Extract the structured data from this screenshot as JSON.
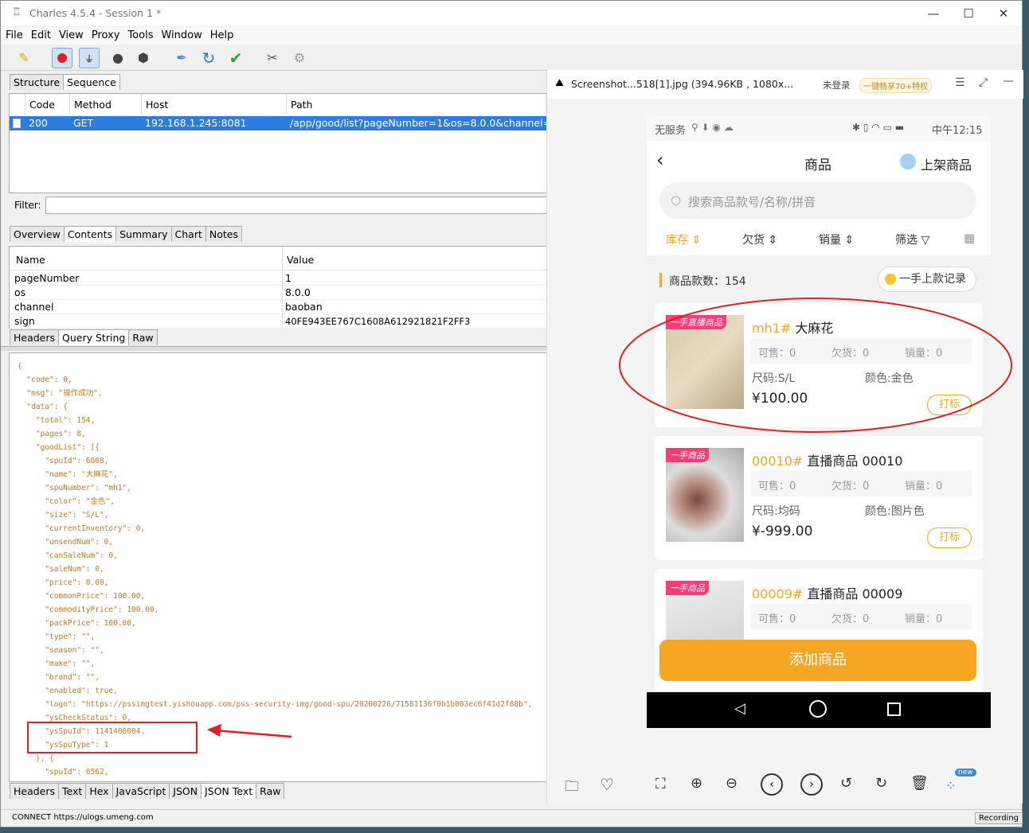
{
  "window": {
    "title": "Charles 4.5.4 - Session 1 *",
    "min": "—",
    "max": "☐",
    "close": "✕"
  },
  "menu": [
    "File",
    "Edit",
    "View",
    "Proxy",
    "Tools",
    "Window",
    "Help"
  ],
  "tabs_top": {
    "structure": "Structure",
    "sequence": "Sequence"
  },
  "table": {
    "headers": [
      "Code",
      "Method",
      "Host",
      "Path"
    ],
    "row": {
      "code": "200",
      "method": "GET",
      "host": "192.168.1.245:8081",
      "path": "/app/good/list?pageNumber=1&os=8.0.0&channel=baob"
    }
  },
  "filter_label": "Filter:",
  "detail_tabs": [
    "Overview",
    "Contents",
    "Summary",
    "Chart",
    "Notes"
  ],
  "kv": {
    "headers": [
      "Name",
      "Value"
    ],
    "rows": [
      {
        "n": "pageNumber",
        "v": "1"
      },
      {
        "n": "os",
        "v": "8.0.0"
      },
      {
        "n": "channel",
        "v": "baoban"
      },
      {
        "n": "sign",
        "v": "40FE943EE767C1608A612921821F2FF3"
      }
    ]
  },
  "sub_tabs": [
    "Headers",
    "Query String",
    "Raw"
  ],
  "json_lines": [
    "{",
    "  \"code\": 0,",
    "  \"msg\": \"操作成功\",",
    "  \"data\": {",
    "    \"total\": 154,",
    "    \"pages\": 8,",
    "    \"goodList\": [{",
    "      \"spuId\": 6808,",
    "      \"name\": \"大麻花\",",
    "      \"spuNumber\": \"mh1\",",
    "      \"color\": \"金色\",",
    "      \"size\": \"S/L\",",
    "      \"currentInventory\": 0,",
    "      \"unsendNum\": 0,",
    "      \"canSaleNum\": 0,",
    "      \"saleNum\": 0,",
    "      \"price\": 0.00,",
    "      \"commonPrice\": 100.00,",
    "      \"commodityPrice\": 100.00,",
    "      \"packPrice\": 100.00,",
    "      \"type\": \"\",",
    "      \"season\": \"\",",
    "      \"make\": \"\",",
    "      \"brand\": \"\",",
    "      \"enabled\": true,",
    "      \"logo\": \"https://pssimgtest.yishouapp.com/pss-security-img/good-spu/20200226/71581136f0b1b003ec6f41d2f88b\",",
    "      \"ysCheckStatus\": 0,",
    "      \"ysSpuId\": 1141400004,",
    "      \"ysSpuType\": 1",
    "    }, {",
    "      \"spuId\": 6562,"
  ],
  "bottom_tabs": [
    "Headers",
    "Text",
    "Hex",
    "JavaScript",
    "JSON",
    "JSON Text",
    "Raw"
  ],
  "status": {
    "left": "CONNECT https://ulogs.umeng.com",
    "right": "Recording"
  },
  "viewer": {
    "title": "Screenshot...518[1].jpg (394.96KB , 1080x...",
    "login": "未登录",
    "promo": "一键畅享70+特权"
  },
  "phone": {
    "statusbar_left": "无服务",
    "statusbar_right": "中午12:15",
    "title": "商品",
    "shelve": "上架商品",
    "search_placeholder": "搜索商品款号/名称/拼音",
    "filters": [
      "库存",
      "欠货",
      "销量",
      "筛选"
    ],
    "count_label": "商品款数：154",
    "history_btn": "一手上款记录",
    "cards": [
      {
        "tag": "一手直播商品",
        "code": "mh1#",
        "name": "大麻花",
        "stats": [
          "可售：0",
          "欠货：0",
          "销量：0"
        ],
        "size": "尺码:S/L",
        "color": "颜色:金色",
        "price": "¥100.00",
        "btn": "打标"
      },
      {
        "tag": "一手商品",
        "code": "00010#",
        "name": "直播商品 00010",
        "stats": [
          "可售：0",
          "欠货：0",
          "销量：0"
        ],
        "size": "尺码:均码",
        "color": "颜色:图片色",
        "price": "¥-999.00",
        "btn": "打标"
      },
      {
        "tag": "一手商品",
        "code": "00009#",
        "name": "直播商品 00009",
        "stats": [
          "可售：0",
          "欠货：0",
          "销量：0"
        ]
      }
    ],
    "add_btn": "添加商品"
  },
  "new_badge": "new",
  "colors": {
    "accent": "#f5a623",
    "selection": "#2b7de0",
    "annotation": "#e02020"
  }
}
